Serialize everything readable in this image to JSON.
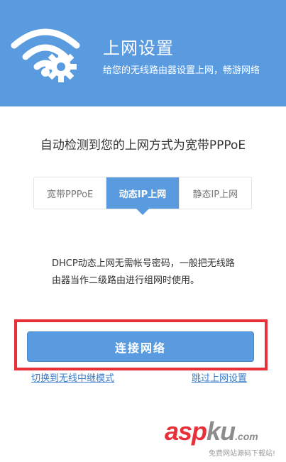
{
  "header": {
    "title": "上网设置",
    "subtitle": "给您的无线路由器设置上网，畅游网络",
    "logo_icon": "wifi-gear-icon"
  },
  "main": {
    "detect_text": "自动检测到您的上网方式为宽带PPPoE",
    "tabs": [
      {
        "label": "宽带PPPoE",
        "active": false
      },
      {
        "label": "动态IP上网",
        "active": true
      },
      {
        "label": "静态IP上网",
        "active": false
      }
    ],
    "description": "DHCP动态上网无需帐号密码，一般把无线路由器当作二级路由进行组网时使用。",
    "connect_button": "连接网络",
    "links": {
      "switch_repeater": "切换到无线中继模式",
      "skip": "跳过上网设置"
    }
  },
  "watermark": {
    "brand_a": "asp",
    "brand_b": "ku",
    "brand_c": ".com",
    "sub": "免费网站源码下载站!"
  },
  "colors": {
    "primary": "#5A9BE0",
    "highlight": "#E8303A",
    "link": "#3A7BC8"
  }
}
